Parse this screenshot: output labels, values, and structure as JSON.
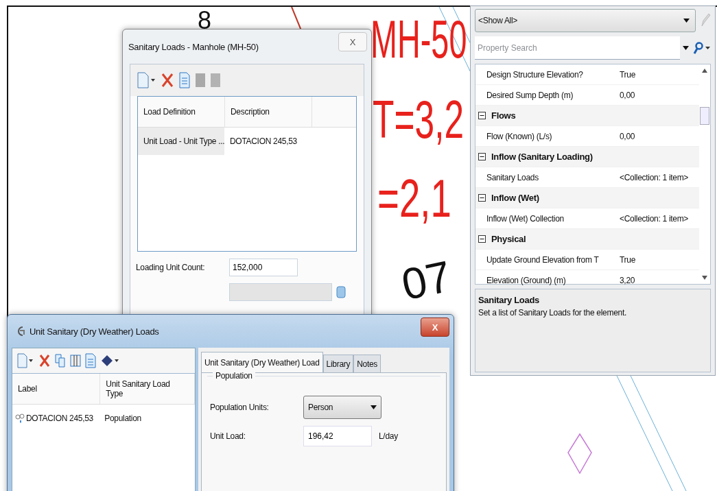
{
  "canvas": {
    "labels": [
      {
        "kind": "black",
        "text": "8"
      },
      {
        "kind": "red",
        "text": "MH-50"
      },
      {
        "kind": "red",
        "text": "T=3,2"
      },
      {
        "kind": "red",
        "text": "=2,1"
      },
      {
        "kind": "black",
        "text": "07"
      }
    ]
  },
  "sanitary_loads_dialog": {
    "title": "Sanitary Loads - Manhole (MH-50)",
    "close": "X",
    "table": {
      "columns": [
        "Load Definition",
        "Description"
      ],
      "rows": [
        {
          "cells": [
            "Unit Load - Unit Type ...",
            "DOTACION 245,53"
          ]
        }
      ]
    },
    "fields": [
      {
        "label": "Loading Unit Count:",
        "value": "152,000"
      }
    ]
  },
  "property_panel": {
    "filter": "<Show All>",
    "search": {
      "placeholder": "Property Search"
    },
    "rows": [
      {
        "kind": "property",
        "name": "Design Structure Elevation?",
        "value": "True"
      },
      {
        "kind": "property",
        "name": "Desired Sump Depth (m)",
        "value": "0,00"
      },
      {
        "kind": "category",
        "name": "Flows",
        "expanded": true
      },
      {
        "kind": "property",
        "name": "Flow (Known) (L/s)",
        "value": "0,00"
      },
      {
        "kind": "category",
        "name": "Inflow (Sanitary Loading)",
        "expanded": true
      },
      {
        "kind": "property",
        "name": "Sanitary Loads",
        "value": "<Collection: 1 item>"
      },
      {
        "kind": "category",
        "name": "Inflow (Wet)",
        "expanded": true
      },
      {
        "kind": "property",
        "name": "Inflow (Wet) Collection",
        "value": "<Collection: 1 item>"
      },
      {
        "kind": "category",
        "name": "Physical",
        "expanded": true
      },
      {
        "kind": "property",
        "name": "Update Ground Elevation from T",
        "value": "True"
      },
      {
        "kind": "property",
        "name": "Elevation (Ground) (m)",
        "value": "3,20"
      }
    ],
    "description": {
      "title": "Sanitary Loads",
      "text": "Set a list of Sanitary Loads for the element."
    }
  },
  "unit_loads_dialog": {
    "title": "Unit Sanitary (Dry Weather) Loads",
    "close": "X",
    "list": {
      "columns": [
        "Label",
        "Unit Sanitary Load Type"
      ],
      "rows": [
        {
          "cells": [
            "DOTACION 245,53",
            "Population"
          ]
        }
      ]
    },
    "tabs": [
      {
        "label": "Unit Sanitary (Dry Weather) Load",
        "selected": true
      },
      {
        "label": "Library",
        "selected": false
      },
      {
        "label": "Notes",
        "selected": false
      }
    ],
    "group": "Population",
    "fields": [
      {
        "kind": "select",
        "label": "Population Units:",
        "value": "Person"
      },
      {
        "kind": "input",
        "label": "Unit Load:",
        "value": "196,42",
        "unit": "L/day"
      }
    ]
  }
}
